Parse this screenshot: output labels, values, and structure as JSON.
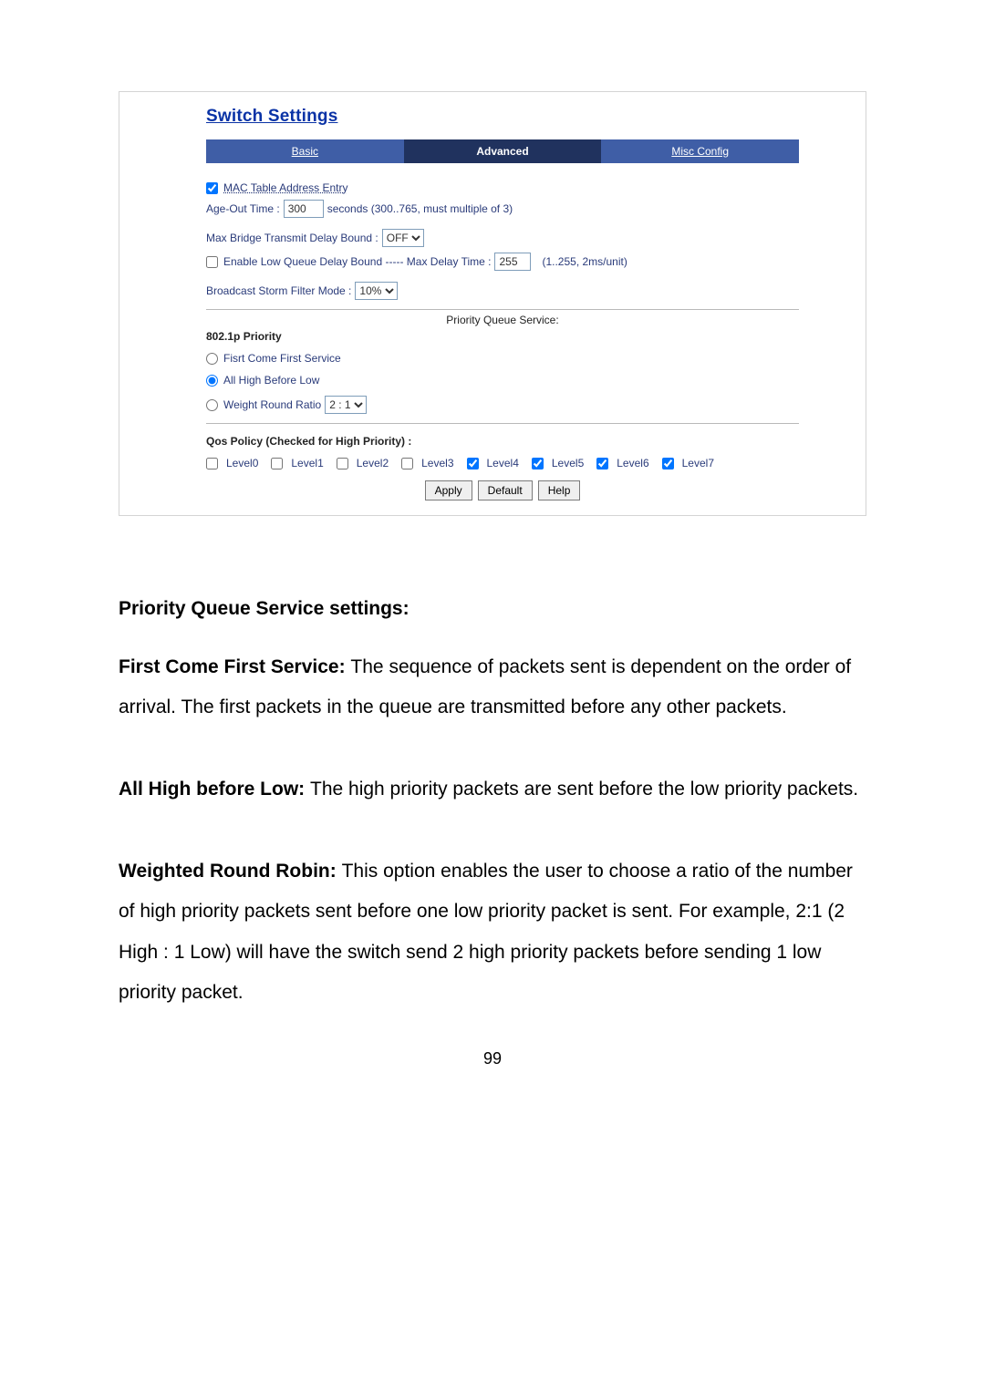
{
  "title": "Switch Settings",
  "tabs": {
    "basic": "Basic",
    "advanced": "Advanced",
    "misc": "Misc Config"
  },
  "mac": {
    "label": "MAC Table Address Entry",
    "checked": true,
    "ageout_label": "Age-Out Time :",
    "ageout_value": "300",
    "ageout_hint": "seconds (300..765, must multiple of 3)"
  },
  "bridge": {
    "label": "Max Bridge Transmit Delay Bound :",
    "select_value": "OFF",
    "lowq_checked": false,
    "lowq_label": "Enable Low Queue Delay Bound ----- Max Delay Time :",
    "lowq_value": "255",
    "lowq_hint": "(1..255, 2ms/unit)"
  },
  "storm": {
    "label": "Broadcast Storm Filter Mode :",
    "value": "10%"
  },
  "pqs_heading": "Priority Queue Service:",
  "p8021p": {
    "heading": "802.1p Priority",
    "first": "Fisrt Come First Service",
    "allhigh": "All High Before Low",
    "wrr": "Weight Round Ratio",
    "wrr_value": "2 : 1",
    "selected": "allhigh"
  },
  "qos": {
    "heading": "Qos Policy (Checked for High Priority) :",
    "levels": [
      {
        "label": "Level0",
        "checked": false
      },
      {
        "label": "Level1",
        "checked": false
      },
      {
        "label": "Level2",
        "checked": false
      },
      {
        "label": "Level3",
        "checked": false
      },
      {
        "label": "Level4",
        "checked": true
      },
      {
        "label": "Level5",
        "checked": true
      },
      {
        "label": "Level6",
        "checked": true
      },
      {
        "label": "Level7",
        "checked": true
      }
    ]
  },
  "buttons": {
    "apply": "Apply",
    "default": "Default",
    "help": "Help"
  },
  "doc": {
    "h": "Priority Queue Service settings:",
    "p1a": "First Come First Service: ",
    "p1b": "The sequence of packets sent is dependent on the order of arrival.    The first packets in the queue are transmitted before any other packets.",
    "p2a": "All High before Low: ",
    "p2b": "The high priority packets are sent before the low priority packets.",
    "p3a": "Weighted Round Robin: ",
    "p3b": "This option enables the user to choose a ratio of the number of high priority packets sent before one low priority packet is sent. For example, 2:1 (2 High : 1 Low) will have the switch send 2 high priority packets before sending 1 low priority packet."
  },
  "page_number": "99"
}
